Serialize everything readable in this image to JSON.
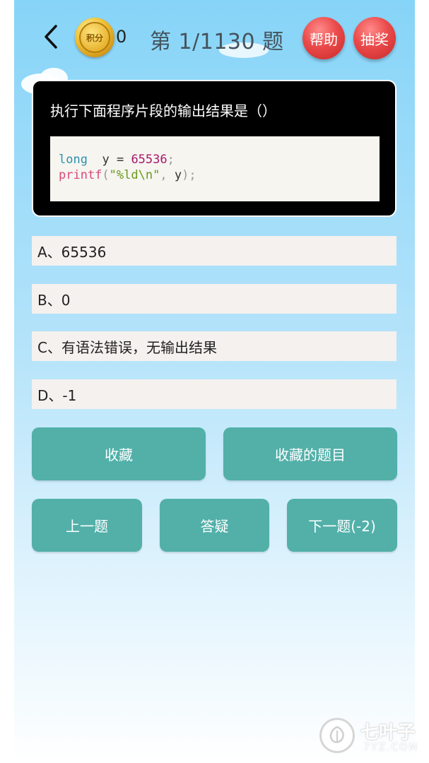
{
  "header": {
    "coin_label": "积分",
    "score": "0",
    "progress": "第 1/1130 题",
    "help_label": "帮助",
    "lottery_label": "抽奖"
  },
  "question": {
    "text": "执行下面程序片段的输出结果是（）",
    "code": {
      "line1": {
        "type": "long",
        "var": "y",
        "eq": "=",
        "num": "65536",
        "semi": ";"
      },
      "line2": {
        "fn": "printf",
        "open": "(",
        "str": "\"%ld\\n\"",
        "comma": ",",
        "arg": "y",
        "close": ");"
      }
    }
  },
  "options": [
    {
      "label": "A、65536"
    },
    {
      "label": "B、0"
    },
    {
      "label": "C、有语法错误，无输出结果"
    },
    {
      "label": "D、-1"
    }
  ],
  "actions": {
    "favorite": "收藏",
    "favorite_list": "收藏的题目",
    "prev": "上一题",
    "answer": "答疑",
    "next": "下一题(-2)"
  },
  "watermark": {
    "title": "七叶子",
    "subtitle": "7YZ.COM"
  },
  "colors": {
    "teal": "#52b0a9",
    "red": "#ea4a4a",
    "sky": "#86d4f8"
  }
}
